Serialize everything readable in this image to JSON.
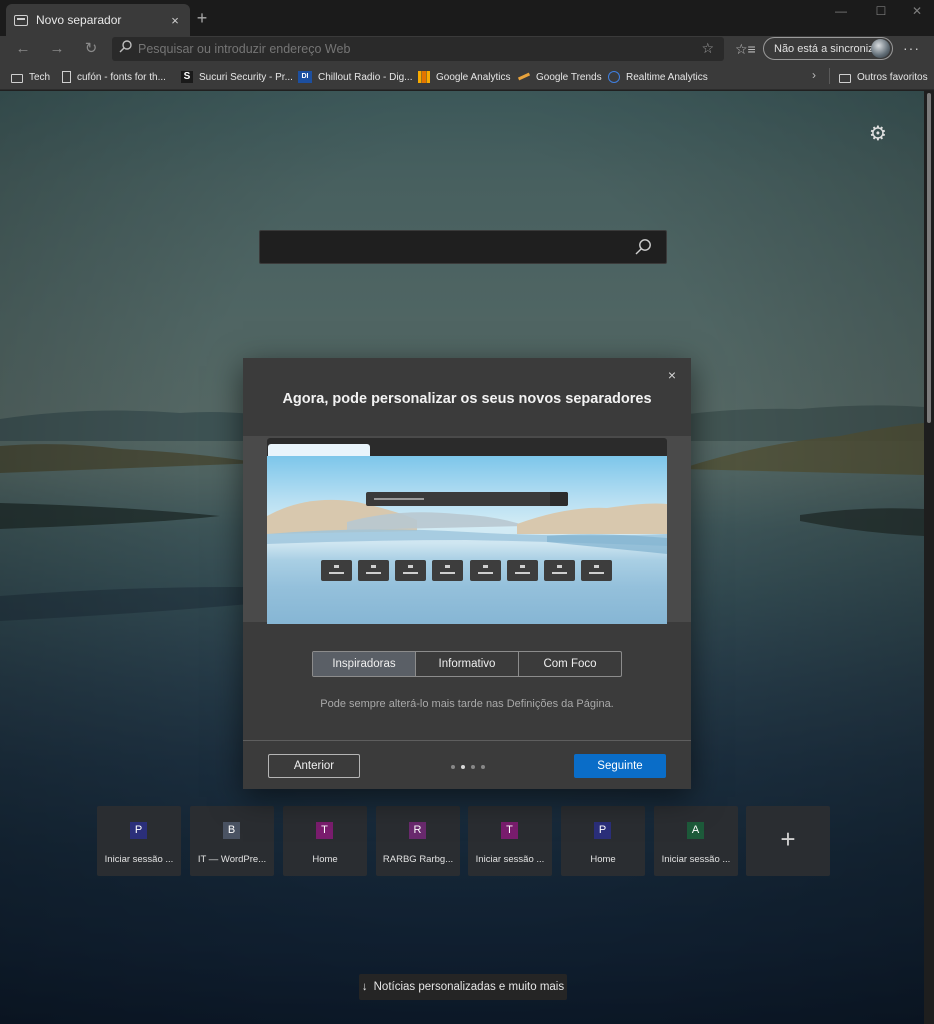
{
  "window": {
    "tab_title": "Novo separador",
    "tab_close": "×",
    "new_tab": "+",
    "controls": {
      "minimize": "—",
      "maximize": "☐",
      "close": "✕"
    }
  },
  "navbar": {
    "back": "←",
    "forward": "→",
    "refresh": "↻",
    "address_placeholder": "Pesquisar ou introduzir endereço Web",
    "favorite_star": "☆",
    "favorites_list": "☆≡",
    "sync_label": "Não está a sincronizar",
    "more": "···"
  },
  "bookmarks": {
    "items": [
      {
        "label": "Tech",
        "icon": "folder-icon"
      },
      {
        "label": "cufón - fonts for th...",
        "icon": "page-icon"
      },
      {
        "label": "Sucuri Security - Pr...",
        "icon": "sucuri-icon",
        "badge": "S"
      },
      {
        "label": "Chillout Radio - Dig...",
        "icon": "di-icon",
        "badge": "DI"
      },
      {
        "label": "Google Analytics",
        "icon": "google-analytics-icon"
      },
      {
        "label": "Google Trends",
        "icon": "google-trends-icon"
      },
      {
        "label": "Realtime Analytics",
        "icon": "realtime-icon"
      }
    ],
    "overflow": "›",
    "other": "Outros favoritos"
  },
  "page": {
    "search_placeholder": "",
    "settings": "⚙",
    "quick_links": [
      {
        "letter": "P",
        "label": "Iniciar sessão ...",
        "color": "#2b2f7a"
      },
      {
        "letter": "B",
        "label": "IT — WordPre...",
        "color": "#4a5363"
      },
      {
        "letter": "T",
        "label": "Home",
        "color": "#7a1d6e"
      },
      {
        "letter": "R",
        "label": "RARBG Rarbg...",
        "color": "#6a2a6e"
      },
      {
        "letter": "T",
        "label": "Iniciar sessão ...",
        "color": "#7a1d6e"
      },
      {
        "letter": "P",
        "label": "Home",
        "color": "#2b2f7a"
      },
      {
        "letter": "A",
        "label": "Iniciar sessão ...",
        "color": "#1d5a3a"
      }
    ],
    "add_tile": "+",
    "news_button": "Notícias personalizadas e muito mais",
    "news_arrow": "↓"
  },
  "modal": {
    "title": "Agora, pode personalizar os seus novos separadores",
    "close": "×",
    "options": [
      "Inspiradoras",
      "Informativo",
      "Com Foco"
    ],
    "selected_option": "Inspiradoras",
    "hint": "Pode sempre alterá-lo mais tarde nas Definições da Página.",
    "prev_label": "Anterior",
    "next_label": "Seguinte",
    "pagination": {
      "total": 4,
      "current": 2
    }
  }
}
